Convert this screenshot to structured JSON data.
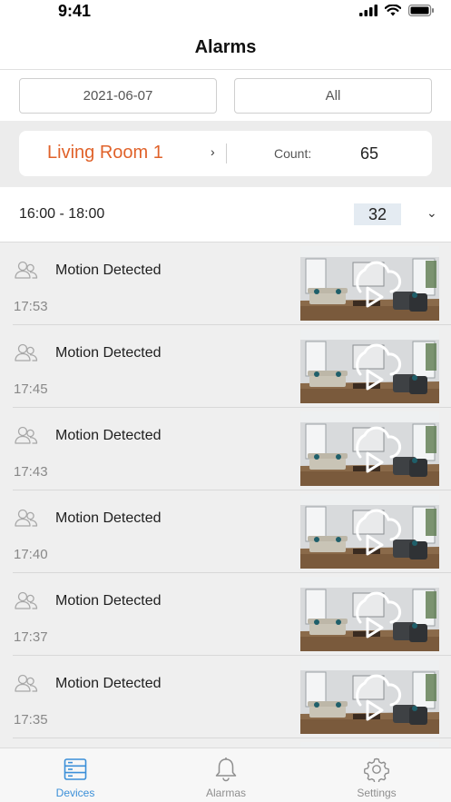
{
  "status_bar": {
    "time": "9:41"
  },
  "nav": {
    "title": "Alarms"
  },
  "filters": {
    "date": "2021-06-07",
    "type": "All"
  },
  "device": {
    "name": "Living Room 1",
    "count_label": "Count:",
    "count_value": "65"
  },
  "time_range": {
    "label": "16:00 - 18:00",
    "count": "32"
  },
  "alarms": [
    {
      "title": "Motion Detected",
      "time": "17:53"
    },
    {
      "title": "Motion Detected",
      "time": "17:45"
    },
    {
      "title": "Motion Detected",
      "time": "17:43"
    },
    {
      "title": "Motion Detected",
      "time": "17:40"
    },
    {
      "title": "Motion Detected",
      "time": "17:37"
    },
    {
      "title": "Motion Detected",
      "time": "17:35"
    }
  ],
  "tabs": [
    {
      "label": "Devices",
      "icon": "devices-icon",
      "active": true
    },
    {
      "label": "Alarmas",
      "icon": "bell-icon",
      "active": false
    },
    {
      "label": "Settings",
      "icon": "gear-icon",
      "active": false
    }
  ],
  "colors": {
    "accent": "#e0622a",
    "tab_active": "#3b8fd8",
    "list_bg": "#efefef"
  }
}
